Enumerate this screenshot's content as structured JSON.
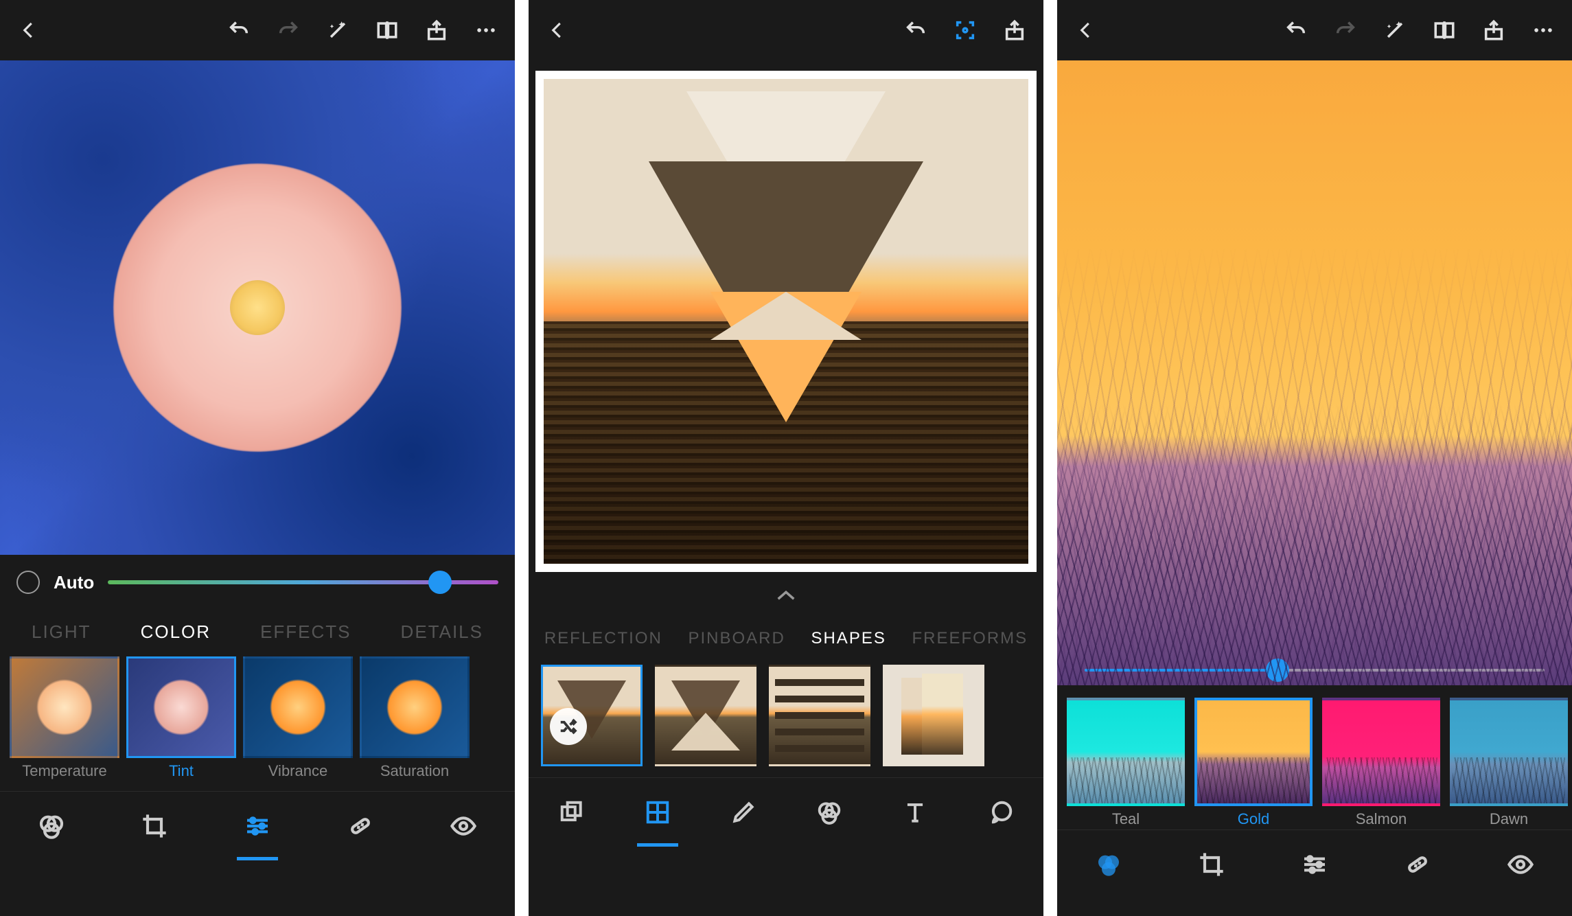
{
  "screen1": {
    "auto_label": "Auto",
    "slider_value_pct": 85,
    "tabs": [
      "LIGHT",
      "COLOR",
      "EFFECTS",
      "DETAILS"
    ],
    "active_tab": "COLOR",
    "thumbs": [
      {
        "label": "Temperature"
      },
      {
        "label": "Tint",
        "selected": true
      },
      {
        "label": "Vibrance"
      },
      {
        "label": "Saturation"
      }
    ],
    "bottom_tools": [
      "filters",
      "crop",
      "adjust",
      "heal",
      "eye"
    ],
    "active_bottom_tool": "adjust"
  },
  "screen2": {
    "tabs": [
      "REFLECTION",
      "PINBOARD",
      "SHAPES",
      "FREEFORMS"
    ],
    "active_tab": "SHAPES",
    "shape_thumb_selected_index": 0,
    "bottom_tools": [
      "layers",
      "layout",
      "edit",
      "filters",
      "text",
      "cutout"
    ],
    "active_bottom_tool": "layout"
  },
  "screen3": {
    "slider_value_pct": 42,
    "filters": [
      {
        "label": "Teal"
      },
      {
        "label": "Gold",
        "selected": true
      },
      {
        "label": "Salmon"
      },
      {
        "label": "Dawn"
      }
    ],
    "bottom_tools": [
      "filters",
      "crop",
      "adjust",
      "heal",
      "eye"
    ],
    "active_bottom_tool": "filters"
  }
}
